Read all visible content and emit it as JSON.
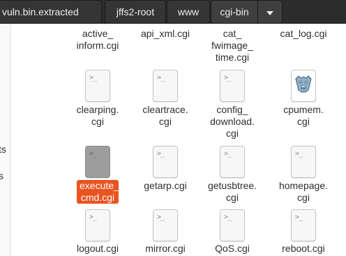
{
  "pathbar": {
    "crumbs": [
      "vuln.bin.extracted",
      "jffs2-root",
      "www",
      "cgi-bin"
    ]
  },
  "sidebar": {
    "fragments": [
      "ts",
      "s"
    ]
  },
  "files": [
    {
      "name": "active_\ninform.cgi",
      "icon": "script-icon"
    },
    {
      "name": "api_xml.cgi",
      "icon": "script-icon"
    },
    {
      "name": "cat_\nfwimage_\ntime.cgi",
      "icon": "script-icon"
    },
    {
      "name": "cat_log.cgi",
      "icon": "script-icon"
    },
    {
      "name": "clearping.\ncgi",
      "icon": "script-icon",
      "prompt": ">_"
    },
    {
      "name": "cleartrace.\ncgi",
      "icon": "script-icon",
      "prompt": ">_"
    },
    {
      "name": "config_\ndownload.\ncgi",
      "icon": "script-icon",
      "prompt": ">_"
    },
    {
      "name": "cpumem.\ncgi",
      "icon": "camel-image-icon"
    },
    {
      "name": "execute_\ncmd.cgi",
      "icon": "script-icon",
      "prompt": ">_",
      "selected": true
    },
    {
      "name": "getarp.cgi",
      "icon": "script-icon",
      "prompt": ">_"
    },
    {
      "name": "getusbtree.\ncgi",
      "icon": "script-icon",
      "prompt": ">_"
    },
    {
      "name": "homepage.\ncgi",
      "icon": "script-icon",
      "prompt": ">_"
    },
    {
      "name": "logout.cgi",
      "icon": "script-icon",
      "prompt": ">_"
    },
    {
      "name": "mirror.cgi",
      "icon": "script-icon",
      "prompt": ">_"
    },
    {
      "name": "QoS.cgi",
      "icon": "script-icon",
      "prompt": ">_"
    },
    {
      "name": "reboot.cgi",
      "icon": "script-icon",
      "prompt": ">_"
    }
  ],
  "colors": {
    "selection": "#e95420",
    "pathbar": "#2c2c2c"
  }
}
